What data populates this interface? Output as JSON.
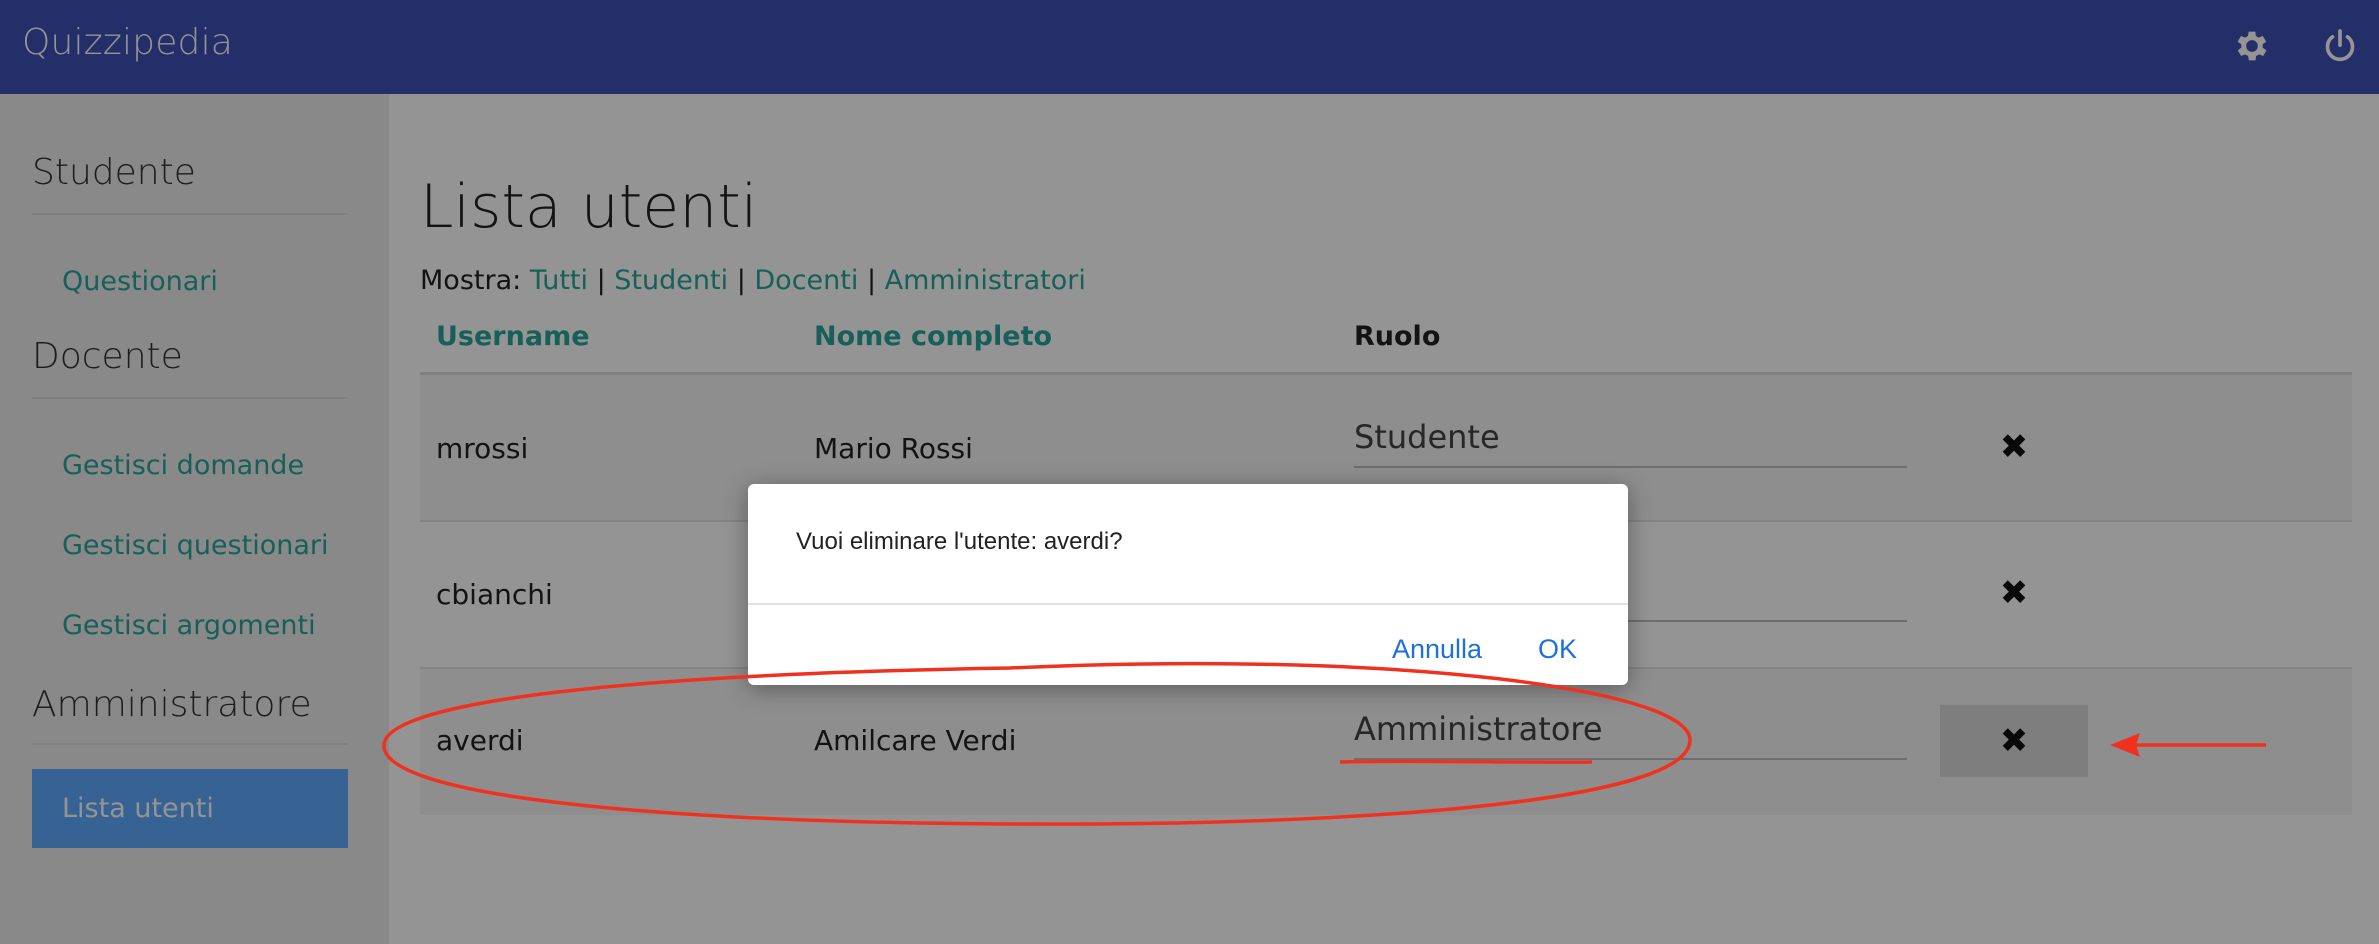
{
  "app": {
    "title": "Quizzipedia"
  },
  "topbar": {
    "settings_icon": "gear-icon",
    "logout_icon": "power-icon"
  },
  "sidebar": {
    "sections": [
      {
        "title": "Studente",
        "items": [
          {
            "label": "Questionari"
          }
        ]
      },
      {
        "title": "Docente",
        "items": [
          {
            "label": "Gestisci domande"
          },
          {
            "label": "Gestisci questionari"
          },
          {
            "label": "Gestisci argomenti"
          }
        ]
      },
      {
        "title": "Amministratore",
        "items": [
          {
            "label": "Lista utenti",
            "active": true
          }
        ]
      }
    ]
  },
  "main": {
    "title": "Lista utenti",
    "filter": {
      "label": "Mostra:",
      "options": [
        "Tutti",
        "Studenti",
        "Docenti",
        "Amministratori"
      ],
      "separator": "|"
    },
    "table": {
      "headers": {
        "username": "Username",
        "fullname": "Nome completo",
        "role": "Ruolo"
      },
      "rows": [
        {
          "username": "mrossi",
          "fullname": "Mario Rossi",
          "role": "Studente",
          "delete": "✖"
        },
        {
          "username": "cbianchi",
          "fullname": "",
          "role": "",
          "delete": "✖"
        },
        {
          "username": "averdi",
          "fullname": "Amilcare Verdi",
          "role": "Amministratore",
          "delete": "✖"
        }
      ]
    }
  },
  "dialog": {
    "message": "Vuoi eliminare l'utente: averdi?",
    "cancel": "Annulla",
    "ok": "OK"
  },
  "colors": {
    "topbar": "#3f51b5",
    "accent": "#26a69a",
    "active": "#5da9ff",
    "dialog_button": "#1e6fe0",
    "annotation": "#f0311f"
  }
}
